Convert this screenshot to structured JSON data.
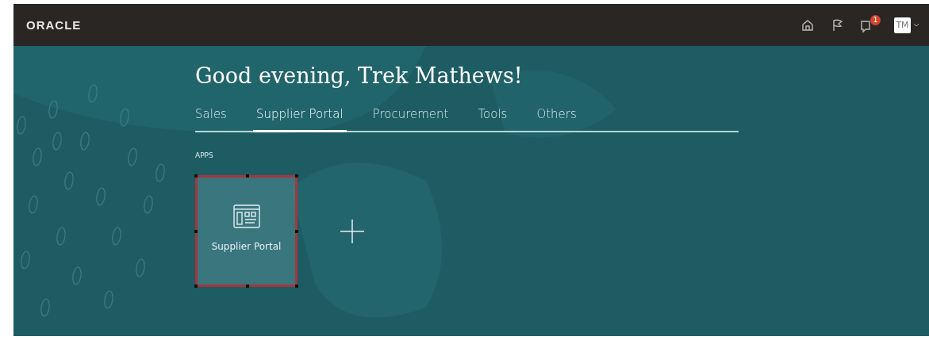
{
  "header": {
    "logo": "ORACLE",
    "notification_count": "1",
    "avatar": "TM"
  },
  "greeting": "Good evening, Trek Mathews!",
  "tabs": [
    {
      "label": "Sales",
      "selected": false
    },
    {
      "label": "Supplier Portal",
      "selected": true
    },
    {
      "label": "Procurement",
      "selected": false
    },
    {
      "label": "Tools",
      "selected": false
    },
    {
      "label": "Others",
      "selected": false
    }
  ],
  "apps": {
    "heading": "APPS",
    "tiles": [
      {
        "label": "Supplier Portal",
        "selected": true
      }
    ]
  }
}
